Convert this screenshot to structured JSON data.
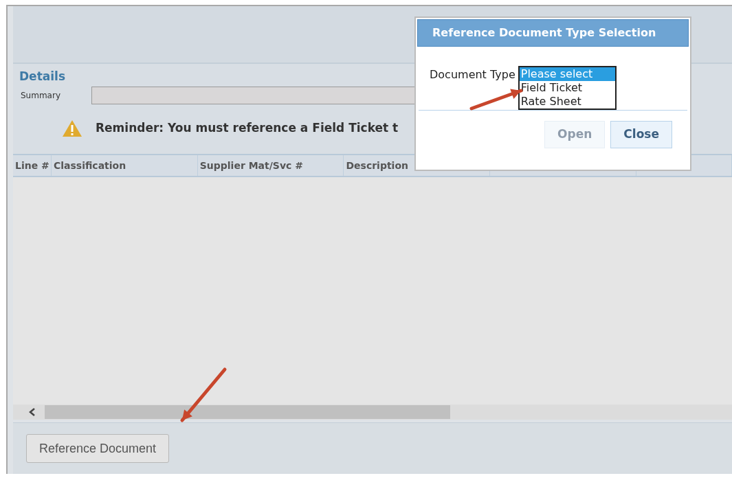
{
  "details": {
    "title": "Details",
    "summary": {
      "label": "Summary"
    }
  },
  "reminder": {
    "text": "Reminder: You must reference a Field Ticket t"
  },
  "table": {
    "columns": [
      "Line #",
      "Classification",
      "Supplier Mat/Svc #",
      "Description"
    ]
  },
  "footer": {
    "buttons": [
      {
        "label": "Reference Document",
        "disabled": false
      }
    ]
  },
  "dialog": {
    "title": "Reference Document Type Selection",
    "field_label": "Document Type",
    "options": [
      {
        "label": "Please select",
        "selected": true
      },
      {
        "label": "Field Ticket",
        "selected": false
      },
      {
        "label": "Rate Sheet",
        "selected": false
      }
    ],
    "buttons": [
      {
        "label": "Open",
        "disabled": true
      },
      {
        "label": "Close",
        "disabled": false
      }
    ]
  }
}
